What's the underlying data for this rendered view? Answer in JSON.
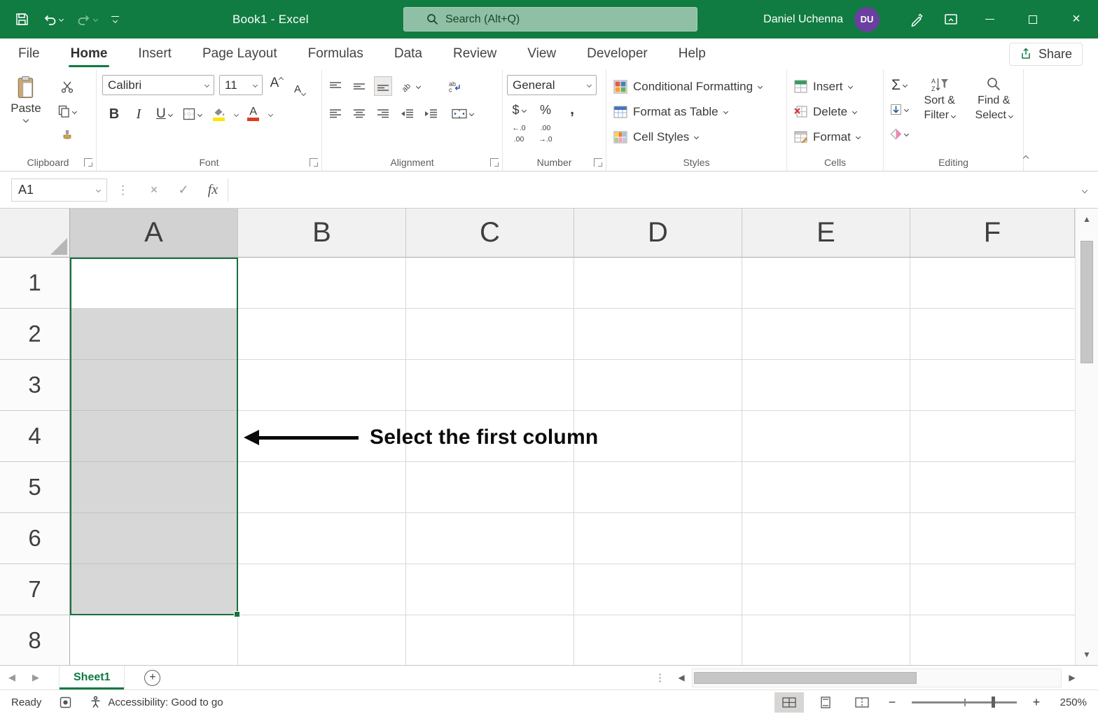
{
  "glyphs": {
    "triangle_up": "▲",
    "triangle_down": "▼",
    "triangle_left": "◀",
    "triangle_right": "▶",
    "close": "×",
    "check": "✓",
    "sigma": "Σ",
    "ellipsis_v": "⋮",
    "minus": "−",
    "plus": "+"
  },
  "colors": {
    "accent_green": "#107C41",
    "selection_fill": "#D6D6D6",
    "fill_color_swatch": "#FFE400",
    "font_color_swatch": "#E03B24",
    "avatar_purple": "#6B3FA0",
    "annotation_black": "#0A0A0A"
  },
  "titlebar": {
    "title": "Book1  -  Excel",
    "search_placeholder": "Search (Alt+Q)",
    "user_name": "Daniel Uchenna",
    "user_initials": "DU"
  },
  "menubar": {
    "tabs": [
      "File",
      "Home",
      "Insert",
      "Page Layout",
      "Formulas",
      "Data",
      "Review",
      "View",
      "Developer",
      "Help"
    ],
    "active_tab": "Home",
    "share": "Share"
  },
  "ribbon": {
    "clipboard": {
      "paste": "Paste",
      "group": "Clipboard"
    },
    "font": {
      "family": "Calibri",
      "size": "11",
      "bold": "B",
      "italic": "I",
      "underline": "U",
      "grow": "A",
      "shrink": "A",
      "color_letter": "A",
      "group": "Font"
    },
    "alignment": {
      "orient_text": "ab",
      "wrap_top": "ab",
      "wrap_bottom": "c",
      "group": "Alignment"
    },
    "number": {
      "format": "General",
      "currency": "$",
      "percent": "%",
      "comma": ",",
      "inc_top": "←.0",
      "inc_bottom": ".00",
      "dec_top": ".00",
      "dec_bottom": "→.0",
      "group": "Number"
    },
    "styles": {
      "conditional": "Conditional Formatting",
      "format_table": "Format as Table",
      "cell_styles": "Cell Styles",
      "group": "Styles"
    },
    "cells": {
      "insert": "Insert",
      "delete": "Delete",
      "format": "Format",
      "group": "Cells"
    },
    "editing": {
      "az_a": "A",
      "az_z": "Z",
      "sort_line1": "Sort &",
      "sort_line2": "Filter",
      "find_line1": "Find &",
      "find_line2": "Select",
      "group": "Editing"
    }
  },
  "formula_bar": {
    "name_box": "A1",
    "fx": "fx"
  },
  "grid": {
    "columns": [
      "A",
      "B",
      "C",
      "D",
      "E",
      "F"
    ],
    "rows": [
      "1",
      "2",
      "3",
      "4",
      "5",
      "6",
      "7",
      "8"
    ],
    "selected_column": "A",
    "selected_range": "A1:A7",
    "annotation": "Select the first column"
  },
  "sheet_bar": {
    "sheet_name": "Sheet1"
  },
  "status_bar": {
    "ready": "Ready",
    "accessibility": "Accessibility: Good to go",
    "zoom": "250%"
  }
}
